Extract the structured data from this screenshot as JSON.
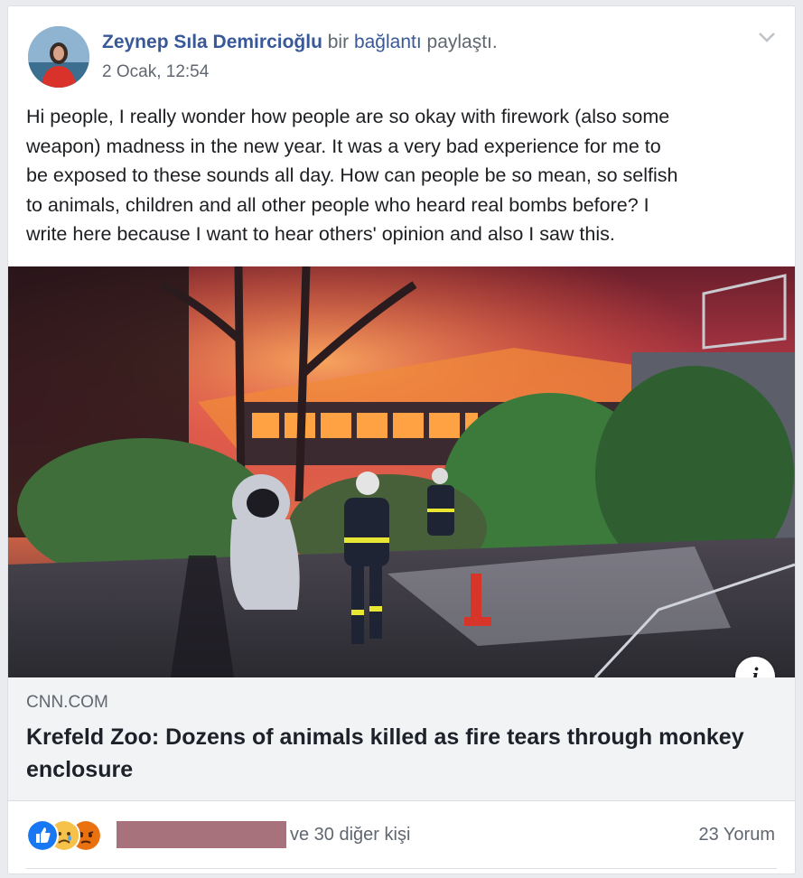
{
  "post": {
    "author": "Zeynep Sıla Demircioğlu",
    "action_prefix": "bir",
    "action_link": "bağlantı",
    "action_suffix": "paylaştı.",
    "timestamp": "2 Ocak, 12:54",
    "text_lines": [
      "Hi people, I really wonder how people are so okay with firework (also some",
      "weapon) madness in the new year. It was a very bad experience for me to",
      "be exposed to these sounds all day. How can people be so mean, so selfish",
      "to animals, children and all other people who heard real bombs before? I",
      "write here because I want to hear others' opinion and also I saw this."
    ]
  },
  "link_preview": {
    "domain": "CNN.COM",
    "title": "Krefeld Zoo: Dozens of animals killed as fire tears through monkey enclosure",
    "info_label": "i"
  },
  "footer": {
    "reaction_icons": [
      "like-icon",
      "sad-icon",
      "angry-icon"
    ],
    "others_text": "ve 30 diğer kişi",
    "comments_text": "23 Yorum"
  },
  "colors": {
    "link_blue": "#385898",
    "secondary_text": "#606770",
    "body_text": "#1c1e21",
    "like_blue": "#1877f2",
    "redaction": "#a8727d"
  }
}
